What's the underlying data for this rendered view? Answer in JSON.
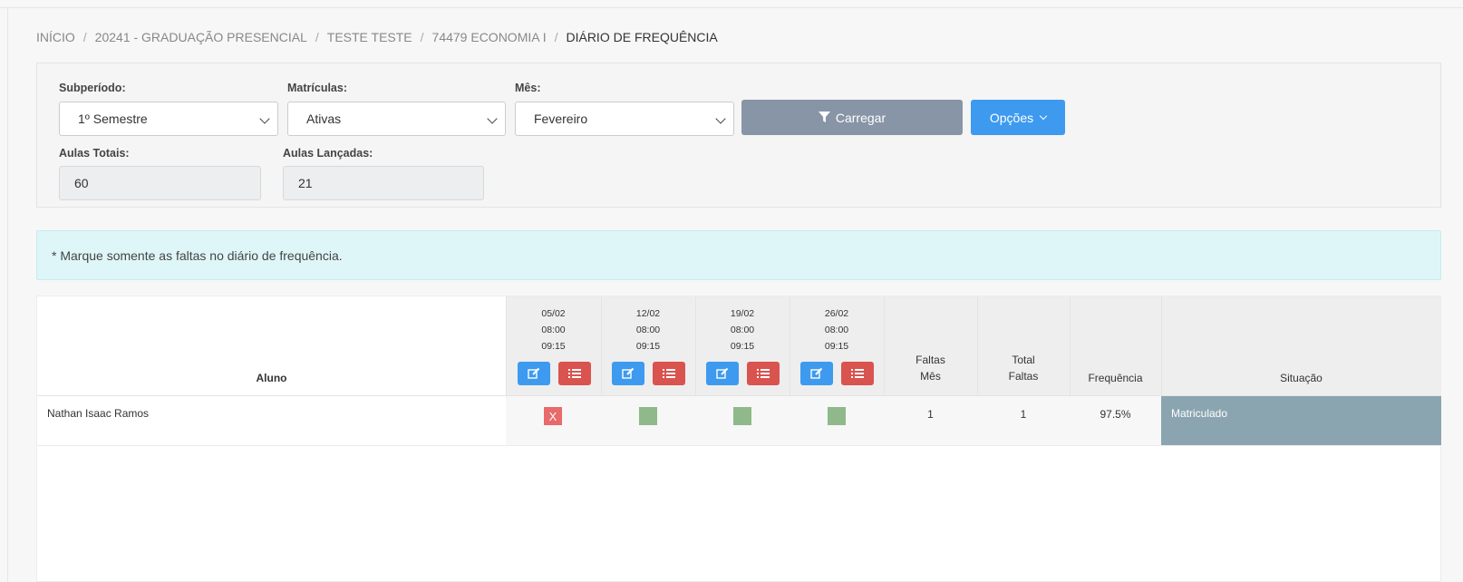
{
  "breadcrumb": [
    {
      "label": "INÍCIO"
    },
    {
      "label": "20241 - GRADUAÇÃO PRESENCIAL"
    },
    {
      "label": "TESTE TESTE"
    },
    {
      "label": "74479 ECONOMIA I"
    },
    {
      "label": "DIÁRIO DE FREQUÊNCIA"
    }
  ],
  "filters": {
    "subperiodo": {
      "label": "Subperíodo:",
      "value": "1º Semestre"
    },
    "matriculas": {
      "label": "Matrículas:",
      "value": "Ativas"
    },
    "mes": {
      "label": "Mês:",
      "value": "Fevereiro"
    },
    "aulas_totais": {
      "label": "Aulas Totais:",
      "value": "60"
    },
    "aulas_lancadas": {
      "label": "Aulas Lançadas:",
      "value": "21"
    },
    "carregar_label": "Carregar",
    "opcoes_label": "Opções"
  },
  "alert": {
    "text": "* Marque somente as faltas no diário de frequência."
  },
  "table": {
    "col_aluno": "Aluno",
    "col_faltas_mes": [
      "Faltas",
      "Mês"
    ],
    "col_total_faltas": [
      "Total",
      "Faltas"
    ],
    "col_frequencia": "Frequência",
    "col_situacao": "Situação",
    "dates": [
      {
        "date": "05/02",
        "start": "08:00",
        "end": "09:15"
      },
      {
        "date": "12/02",
        "start": "08:00",
        "end": "09:15"
      },
      {
        "date": "19/02",
        "start": "08:00",
        "end": "09:15"
      },
      {
        "date": "26/02",
        "start": "08:00",
        "end": "09:15"
      }
    ],
    "rows": [
      {
        "aluno": "Nathan Isaac Ramos",
        "attendance": [
          "X",
          "",
          "",
          ""
        ],
        "faltas_mes": "1",
        "total_faltas": "1",
        "frequencia": "97.5%",
        "situacao": "Matriculado"
      }
    ]
  },
  "colors": {
    "primary": "#3d9aef",
    "danger": "#d9534f",
    "absent": "#e86a6a",
    "present": "#8fb98a",
    "status_bg": "#8aa5b0"
  }
}
